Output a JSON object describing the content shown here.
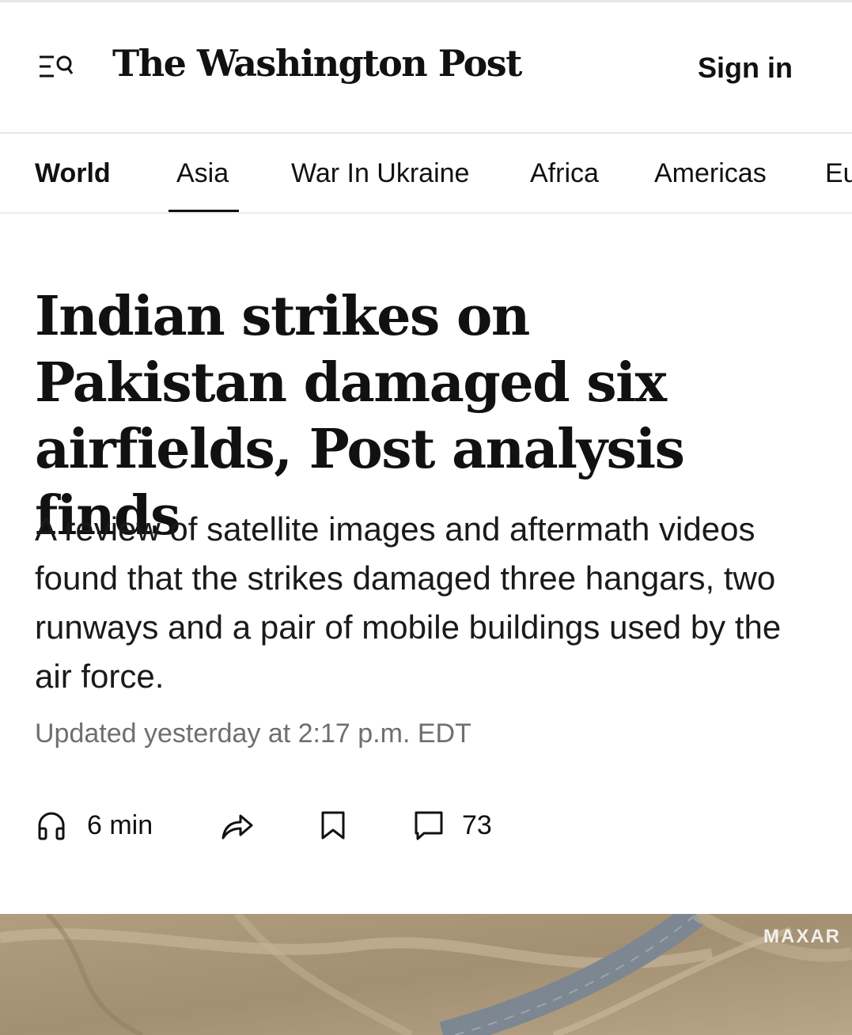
{
  "header": {
    "logo_text": "The Washington Post",
    "sign_in_label": "Sign in",
    "menu_icon": "menu-search-icon"
  },
  "nav": {
    "items": [
      {
        "label": "World",
        "active_section": true
      },
      {
        "label": "Asia",
        "selected": true
      },
      {
        "label": "War In Ukraine"
      },
      {
        "label": "Africa"
      },
      {
        "label": "Americas"
      },
      {
        "label": "Eu"
      }
    ]
  },
  "article": {
    "headline": "Indian strikes on Pakistan damaged six airfields, Post analysis finds",
    "dek": "A review of satellite images and aftermath videos found that the strikes damaged three hangars, two runways and a pair of mobile buildings used by the air force.",
    "timestamp": "Updated yesterday at 2:17 p.m. EDT"
  },
  "actions": {
    "listen_label": "6 min",
    "listen_icon": "headphones-icon",
    "share_icon": "share-arrow-icon",
    "save_icon": "bookmark-icon",
    "comments_icon": "comment-icon",
    "comments_count": "73"
  },
  "photo": {
    "credit": "MAXAR"
  },
  "colors": {
    "text": "#111111",
    "muted": "#6f6f6f",
    "divider": "#e6e6e6",
    "photo_ground": "#a89478",
    "runway": "#7c8791"
  }
}
